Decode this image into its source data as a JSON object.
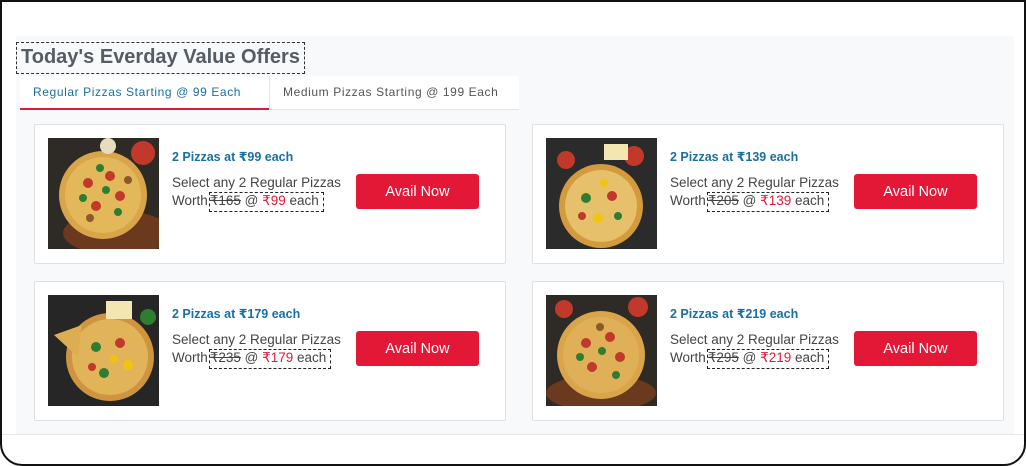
{
  "page": {
    "heading": "Today's Everday Value Offers"
  },
  "tabs": [
    {
      "label": "Regular Pizzas Starting @ 99 Each",
      "active": true
    },
    {
      "label": "Medium Pizzas Starting @ 199 Each",
      "active": false
    }
  ],
  "offers": [
    {
      "title": "2 Pizzas at ₹99 each",
      "line1": "Select any 2 Regular Pizzas",
      "worth_label": "Worth",
      "old_price": "₹165",
      "at": "@",
      "new_price": "₹99",
      "suffix": "each",
      "button": "Avail Now"
    },
    {
      "title": "2 Pizzas at ₹139 each",
      "line1": "Select any 2 Regular Pizzas",
      "worth_label": "Worth",
      "old_price": "₹205",
      "at": "@",
      "new_price": "₹139",
      "suffix": "each",
      "button": "Avail Now"
    },
    {
      "title": "2 Pizzas at ₹179 each",
      "line1": "Select any 2 Regular Pizzas",
      "worth_label": "Worth",
      "old_price": "₹235",
      "at": "@",
      "new_price": "₹179",
      "suffix": "each",
      "button": "Avail Now"
    },
    {
      "title": "2 Pizzas at ₹219 each",
      "line1": "Select any 2 Regular Pizzas",
      "worth_label": "Worth",
      "old_price": "₹295",
      "at": "@",
      "new_price": "₹219",
      "suffix": "each",
      "button": "Avail Now"
    }
  ],
  "colors": {
    "brand_red": "#e31837",
    "title_blue": "#1a6fa3",
    "heading_gray": "#555c64"
  }
}
